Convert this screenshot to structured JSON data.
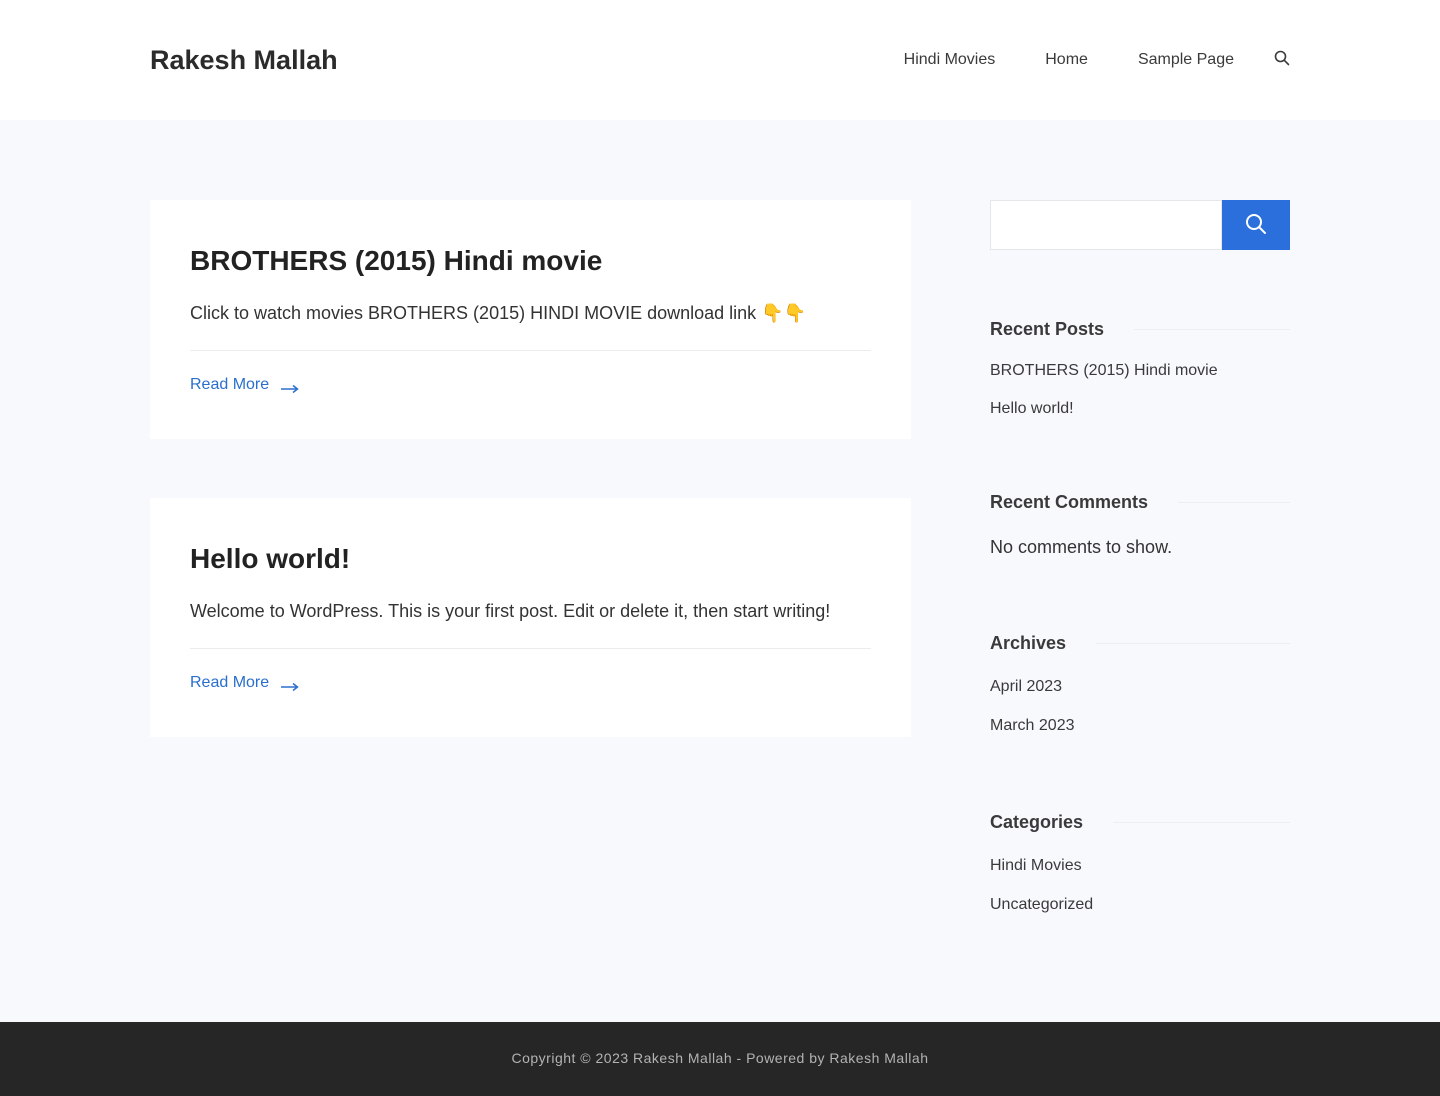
{
  "header": {
    "site_title": "Rakesh Mallah",
    "nav": [
      "Hindi Movies",
      "Home",
      "Sample Page"
    ],
    "search_icon": "search-icon"
  },
  "posts": [
    {
      "title": "BROTHERS (2015) Hindi movie",
      "excerpt": "Click to watch movies BROTHERS (2015) HINDI MOVIE download link 👇👇",
      "read_more": "Read More"
    },
    {
      "title": "Hello world!",
      "excerpt": "Welcome to WordPress. This is your first post. Edit or delete it, then start writing!",
      "read_more": "Read More"
    }
  ],
  "sidebar": {
    "search": {
      "placeholder": "",
      "button_icon": "search-icon",
      "accent": "#2a6fdb"
    },
    "recent_posts": {
      "title": "Recent Posts",
      "items": [
        "BROTHERS (2015) Hindi movie",
        "Hello world!"
      ]
    },
    "recent_comments": {
      "title": "Recent Comments",
      "text": "No comments to show."
    },
    "archives": {
      "title": "Archives",
      "items": [
        "April 2023",
        "March 2023"
      ]
    },
    "categories": {
      "title": "Categories",
      "items": [
        "Hindi Movies",
        "Uncategorized"
      ]
    }
  },
  "footer": {
    "text": "Copyright © 2023 Rakesh Mallah - Powered by Rakesh Mallah"
  },
  "colors": {
    "link": "#2a6fcd",
    "page_bg": "#f8f9fd",
    "footer_bg": "#262626"
  }
}
